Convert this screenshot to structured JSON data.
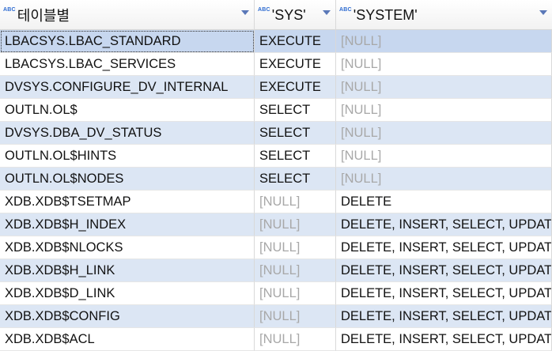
{
  "columns": [
    {
      "type_badge": "ABC",
      "label": "테이블별"
    },
    {
      "type_badge": "ABC",
      "label": "'SYS'"
    },
    {
      "type_badge": "ABC",
      "label": "'SYSTEM'"
    }
  ],
  "rows": [
    {
      "table": "LBACSYS.LBAC_STANDARD",
      "sys": "EXECUTE",
      "system": "[NULL]"
    },
    {
      "table": "LBACSYS.LBAC_SERVICES",
      "sys": "EXECUTE",
      "system": "[NULL]"
    },
    {
      "table": "DVSYS.CONFIGURE_DV_INTERNAL",
      "sys": "EXECUTE",
      "system": "[NULL]"
    },
    {
      "table": "OUTLN.OL$",
      "sys": "SELECT",
      "system": "[NULL]"
    },
    {
      "table": "DVSYS.DBA_DV_STATUS",
      "sys": "SELECT",
      "system": "[NULL]"
    },
    {
      "table": "OUTLN.OL$HINTS",
      "sys": "SELECT",
      "system": "[NULL]"
    },
    {
      "table": "OUTLN.OL$NODES",
      "sys": "SELECT",
      "system": "[NULL]"
    },
    {
      "table": "XDB.XDB$TSETMAP",
      "sys": "[NULL]",
      "system": "DELETE"
    },
    {
      "table": "XDB.XDB$H_INDEX",
      "sys": "[NULL]",
      "system": "DELETE, INSERT, SELECT, UPDATE"
    },
    {
      "table": "XDB.XDB$NLOCKS",
      "sys": "[NULL]",
      "system": "DELETE, INSERT, SELECT, UPDATE"
    },
    {
      "table": "XDB.XDB$H_LINK",
      "sys": "[NULL]",
      "system": "DELETE, INSERT, SELECT, UPDATE"
    },
    {
      "table": "XDB.XDB$D_LINK",
      "sys": "[NULL]",
      "system": "DELETE, INSERT, SELECT, UPDATE"
    },
    {
      "table": "XDB.XDB$CONFIG",
      "sys": "[NULL]",
      "system": "DELETE, INSERT, SELECT, UPDATE"
    },
    {
      "table": "XDB.XDB$ACL",
      "sys": "[NULL]",
      "system": "DELETE, INSERT, SELECT, UPDATE"
    }
  ],
  "selected_row": 0,
  "null_marker": "[NULL]",
  "colors": {
    "row_alt": "#dce6f4",
    "row_selected": "#c7d7ef",
    "null_text": "#a8a8a8",
    "badge": "#2d6bd1"
  }
}
